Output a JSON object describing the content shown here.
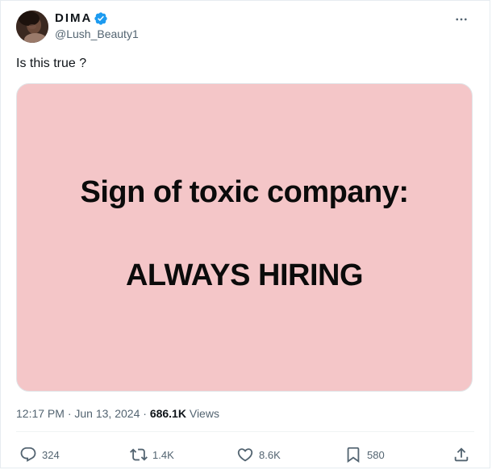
{
  "author": {
    "display_name": "DIMA",
    "handle": "@Lush_Beauty1",
    "verified_color": "#1d9bf0"
  },
  "tweet": {
    "text": "Is this true ?",
    "media": {
      "line1": "Sign of toxic company:",
      "line2": "ALWAYS HIRING",
      "background_color": "#f4c6c8"
    },
    "time": "12:17 PM",
    "separator": "·",
    "date": "Jun 13, 2024",
    "views_count": "686.1K",
    "views_label": "Views"
  },
  "actions": {
    "replies": "324",
    "reposts": "1.4K",
    "likes": "8.6K",
    "bookmarks": "580"
  },
  "icons": {
    "more": "more-icon",
    "reply": "reply-icon",
    "repost": "repost-icon",
    "like": "heart-icon",
    "bookmark": "bookmark-icon",
    "share": "share-icon"
  },
  "colors": {
    "text_primary": "#0f1419",
    "text_secondary": "#536471"
  }
}
